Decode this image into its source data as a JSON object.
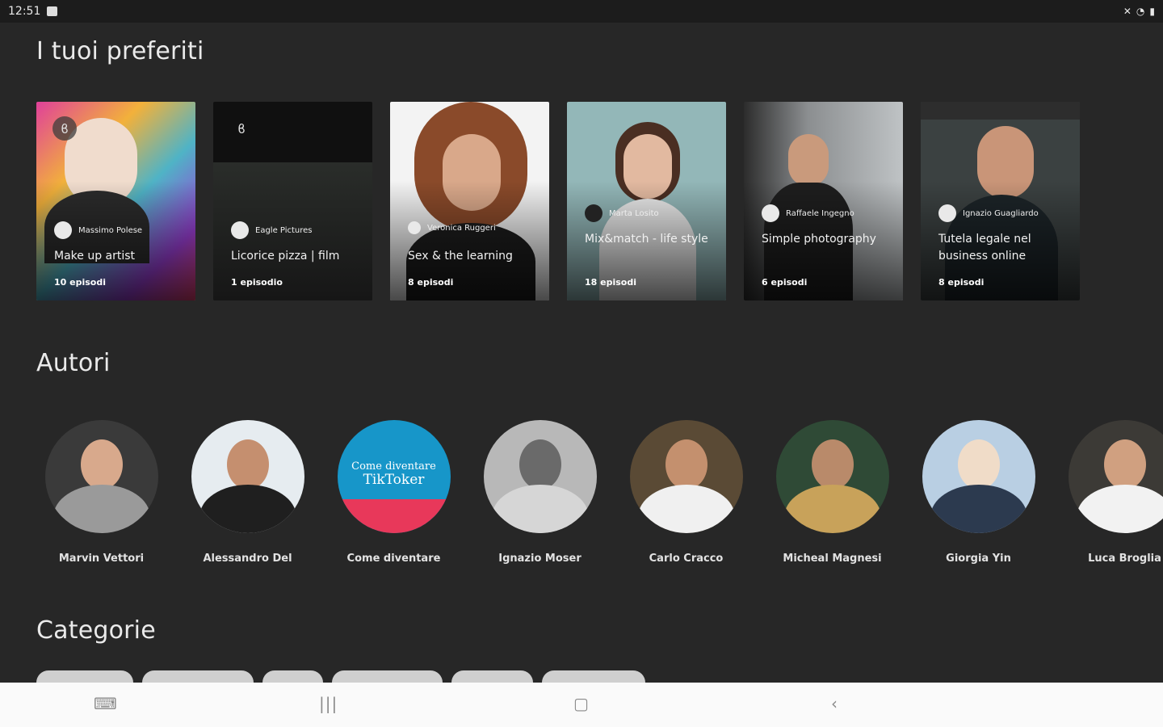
{
  "status": {
    "time": "12:51"
  },
  "favorites": {
    "title": "I tuoi preferiti",
    "cards": [
      {
        "author": "Massimo Polese",
        "title": "Make up artist",
        "episodes": "10 episodi",
        "bg": "#b33a8a"
      },
      {
        "author": "Eagle Pictures",
        "title": "Licorice pizza | film",
        "episodes": "1 episodio",
        "bg": "#141414"
      },
      {
        "author": "Veronica Ruggeri",
        "title": "Sex & the learning",
        "episodes": "8 episodi",
        "bg": "#f2f2f2"
      },
      {
        "author": "Marta Losito",
        "title": "Mix&match - life style",
        "episodes": "18 episodi",
        "bg": "#8fb3b5"
      },
      {
        "author": "Raffaele Ingegno",
        "title": "Simple photography",
        "episodes": "6 episodi",
        "bg": "#7a7d80"
      },
      {
        "author": "Ignazio Guagliardo",
        "title": "Tutela legale nel business online",
        "episodes": "8 episodi",
        "bg": "#3a4040"
      }
    ]
  },
  "authors": {
    "title": "Autori",
    "items": [
      {
        "name": "Marvin Vettori"
      },
      {
        "name": "Alessandro Del"
      },
      {
        "name": "Come diventare",
        "logo_line1": "Come diventare",
        "logo_line2": "TikToker"
      },
      {
        "name": "Ignazio Moser"
      },
      {
        "name": "Carlo Cracco"
      },
      {
        "name": "Micheal Magnesi"
      },
      {
        "name": "Giorgia Yin"
      },
      {
        "name": "Luca Broglia"
      }
    ]
  },
  "categories": {
    "title": "Categorie"
  }
}
